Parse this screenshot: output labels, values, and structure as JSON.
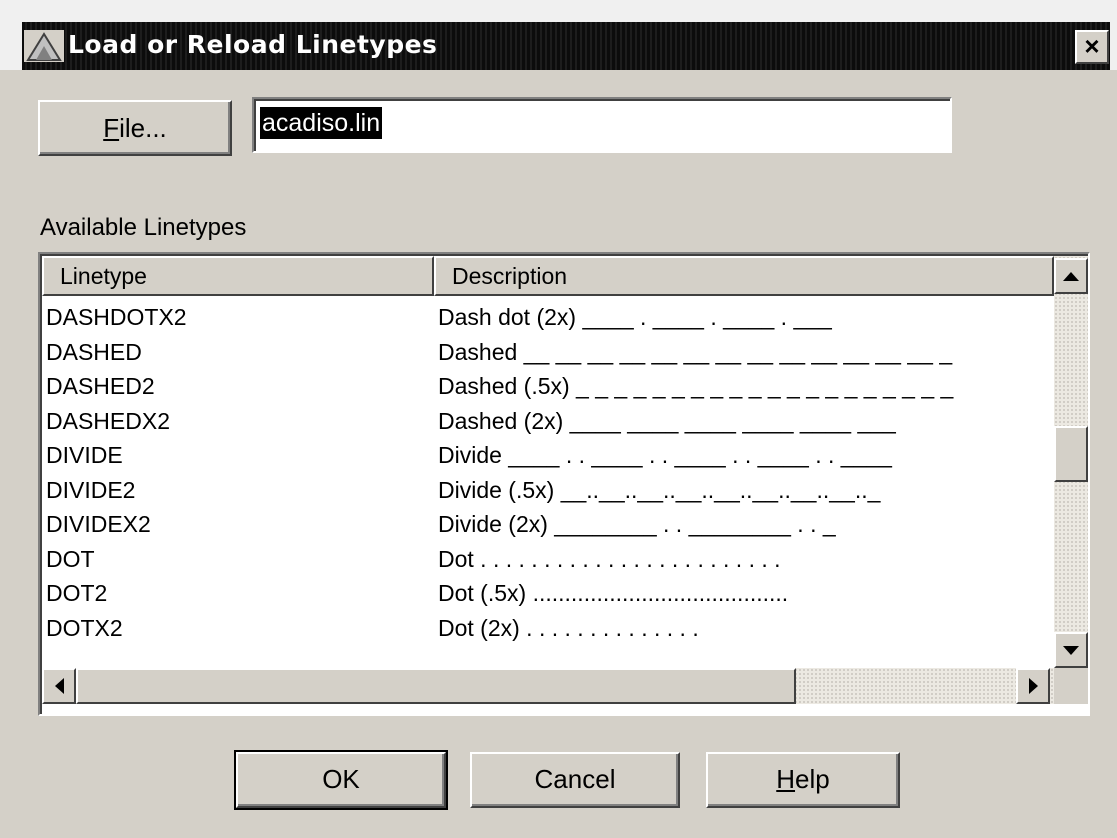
{
  "window": {
    "title": "Load or Reload Linetypes",
    "close_label": "×"
  },
  "file": {
    "button_label": "File...",
    "button_mnemonic": "F",
    "button_rest": "ile...",
    "value": "acadiso.lin"
  },
  "list": {
    "section_label": "Available Linetypes",
    "columns": [
      "Linetype",
      "Description"
    ],
    "rows": [
      {
        "linetype": "DASHDOTX2",
        "description": "Dash dot (2x) ____  .  ____  .  ____  .  ___"
      },
      {
        "linetype": "DASHED",
        "description": "Dashed __ __ __ __ __ __ __ __ __ __ __ __ __ _"
      },
      {
        "linetype": "DASHED2",
        "description": "Dashed (.5x) _ _ _ _ _ _ _ _ _ _ _ _ _ _ _ _ _ _ _ _"
      },
      {
        "linetype": "DASHEDX2",
        "description": "Dashed (2x) ____  ____  ____  ____  ____  ___"
      },
      {
        "linetype": "DIVIDE",
        "description": "Divide ____ . . ____ . . ____ . . ____ . . ____"
      },
      {
        "linetype": "DIVIDE2",
        "description": "Divide (.5x) __..__..__..__..__..__..__..__.._"
      },
      {
        "linetype": "DIVIDEX2",
        "description": "Divide (2x) ________  .  .  ________  .  .  _"
      },
      {
        "linetype": "DOT",
        "description": "Dot . . . . . . . . . . . . . . . . . . . . . . . ."
      },
      {
        "linetype": "DOT2",
        "description": "Dot (.5x) ........................................"
      },
      {
        "linetype": "DOTX2",
        "description": "Dot (2x) .  .  .  .  .  .  .  .  .  .  .  .  .  ."
      }
    ]
  },
  "buttons": {
    "ok": "OK",
    "cancel": "Cancel",
    "help": "Help",
    "help_mnemonic": "H",
    "help_rest": "elp"
  },
  "colors": {
    "dialog_bg": "#d4d0c8",
    "title_bg": "#111111",
    "selection_bg": "#000000"
  },
  "icons": {
    "title": "autocad-app-icon",
    "close": "close-icon",
    "scroll_up": "arrow-up-icon",
    "scroll_down": "arrow-down-icon",
    "scroll_left": "arrow-left-icon",
    "scroll_right": "arrow-right-icon"
  }
}
